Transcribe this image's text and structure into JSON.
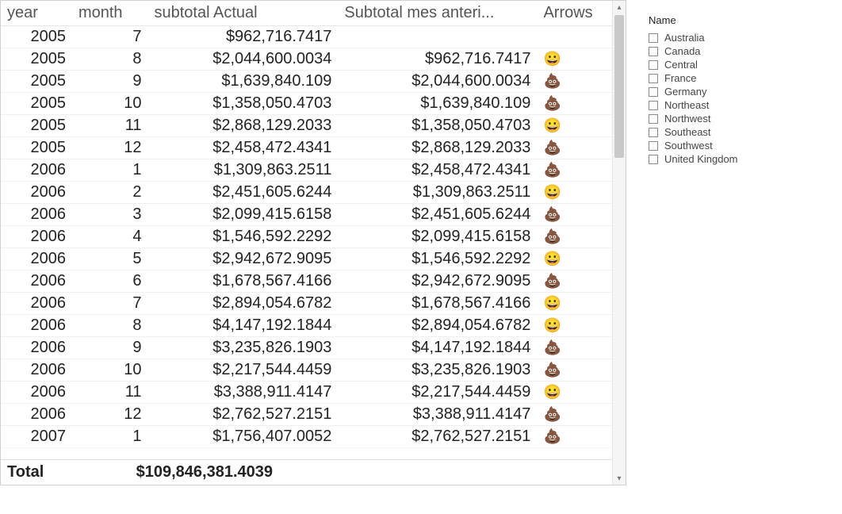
{
  "table": {
    "headers": {
      "year": "year",
      "month": "month",
      "actual": "subtotal Actual",
      "prev": "Subtotal mes anteri...",
      "arrows": "Arrows"
    },
    "rows": [
      {
        "year": "2005",
        "month": "7",
        "actual": "$962,716.7417",
        "prev": "",
        "arrow": ""
      },
      {
        "year": "2005",
        "month": "8",
        "actual": "$2,044,600.0034",
        "prev": "$962,716.7417",
        "arrow": "up"
      },
      {
        "year": "2005",
        "month": "9",
        "actual": "$1,639,840.109",
        "prev": "$2,044,600.0034",
        "arrow": "down"
      },
      {
        "year": "2005",
        "month": "10",
        "actual": "$1,358,050.4703",
        "prev": "$1,639,840.109",
        "arrow": "down"
      },
      {
        "year": "2005",
        "month": "11",
        "actual": "$2,868,129.2033",
        "prev": "$1,358,050.4703",
        "arrow": "up"
      },
      {
        "year": "2005",
        "month": "12",
        "actual": "$2,458,472.4341",
        "prev": "$2,868,129.2033",
        "arrow": "down"
      },
      {
        "year": "2006",
        "month": "1",
        "actual": "$1,309,863.2511",
        "prev": "$2,458,472.4341",
        "arrow": "down"
      },
      {
        "year": "2006",
        "month": "2",
        "actual": "$2,451,605.6244",
        "prev": "$1,309,863.2511",
        "arrow": "up"
      },
      {
        "year": "2006",
        "month": "3",
        "actual": "$2,099,415.6158",
        "prev": "$2,451,605.6244",
        "arrow": "down"
      },
      {
        "year": "2006",
        "month": "4",
        "actual": "$1,546,592.2292",
        "prev": "$2,099,415.6158",
        "arrow": "down"
      },
      {
        "year": "2006",
        "month": "5",
        "actual": "$2,942,672.9095",
        "prev": "$1,546,592.2292",
        "arrow": "up"
      },
      {
        "year": "2006",
        "month": "6",
        "actual": "$1,678,567.4166",
        "prev": "$2,942,672.9095",
        "arrow": "down"
      },
      {
        "year": "2006",
        "month": "7",
        "actual": "$2,894,054.6782",
        "prev": "$1,678,567.4166",
        "arrow": "up"
      },
      {
        "year": "2006",
        "month": "8",
        "actual": "$4,147,192.1844",
        "prev": "$2,894,054.6782",
        "arrow": "up"
      },
      {
        "year": "2006",
        "month": "9",
        "actual": "$3,235,826.1903",
        "prev": "$4,147,192.1844",
        "arrow": "down"
      },
      {
        "year": "2006",
        "month": "10",
        "actual": "$2,217,544.4459",
        "prev": "$3,235,826.1903",
        "arrow": "down"
      },
      {
        "year": "2006",
        "month": "11",
        "actual": "$3,388,911.4147",
        "prev": "$2,217,544.4459",
        "arrow": "up"
      },
      {
        "year": "2006",
        "month": "12",
        "actual": "$2,762,527.2151",
        "prev": "$3,388,911.4147",
        "arrow": "down"
      },
      {
        "year": "2007",
        "month": "1",
        "actual": "$1,756,407.0052",
        "prev": "$2,762,527.2151",
        "arrow": "down"
      }
    ],
    "total": {
      "label": "Total",
      "value": "$109,846,381.4039"
    }
  },
  "filter": {
    "title": "Name",
    "items": [
      "Australia",
      "Canada",
      "Central",
      "France",
      "Germany",
      "Northeast",
      "Northwest",
      "Southeast",
      "Southwest",
      "United Kingdom"
    ]
  },
  "icons": {
    "up": "😀",
    "down": "💩"
  }
}
